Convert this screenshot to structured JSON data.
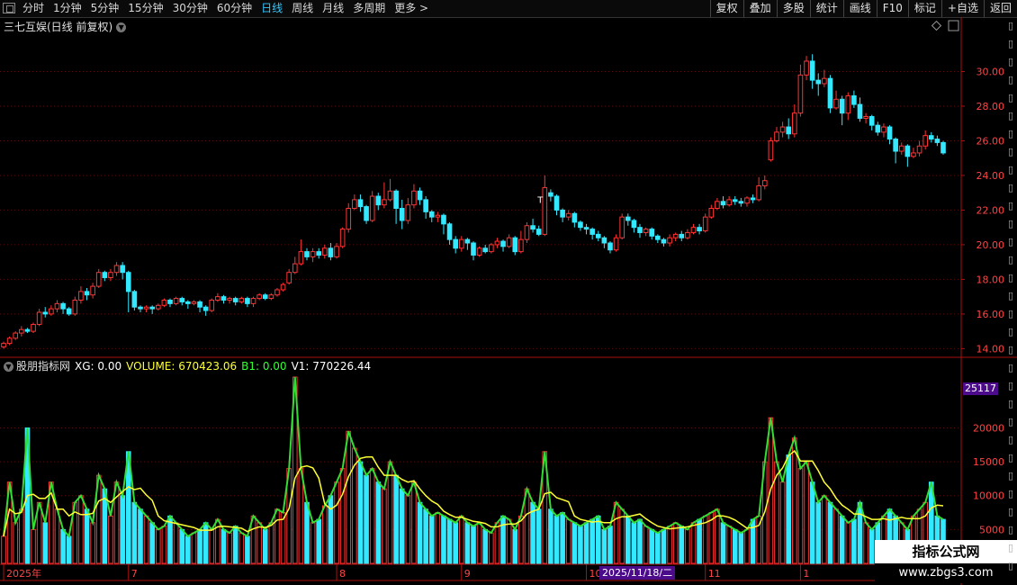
{
  "toolbar": {
    "timeframes": [
      "分时",
      "1分钟",
      "5分钟",
      "15分钟",
      "30分钟",
      "60分钟",
      "日线",
      "周线",
      "月线",
      "多周期",
      "更多 >"
    ],
    "active_index": 6,
    "right_buttons": [
      "复权",
      "叠加",
      "多股",
      "统计",
      "画线",
      "F10",
      "标记",
      "+自选",
      "返回"
    ]
  },
  "main_chart": {
    "title": "三七互娱(日线 前复权)",
    "title_icon": "chevron-down-icon",
    "y_ticks": [
      "30.00",
      "28.00",
      "26.00",
      "24.00",
      "22.00",
      "20.00",
      "18.00",
      "16.00",
      "14.00"
    ],
    "annotation": "T"
  },
  "indicator": {
    "name": "股朋指标网",
    "fields": [
      {
        "label": "XG: 0.00",
        "color": "#ffffff"
      },
      {
        "label": "VOLUME: 670423.06",
        "color": "#ffff33"
      },
      {
        "label": "B1: 0.00",
        "color": "#33ff33"
      },
      {
        "label": "V1: 770226.44",
        "color": "#ffffff"
      }
    ],
    "y_ticks": [
      "20000",
      "15000",
      "10000",
      "5000"
    ],
    "y_tag": "25117"
  },
  "x_axis": {
    "labels": [
      "2025年",
      "7",
      "8",
      "9",
      "10",
      "11",
      "1"
    ],
    "cursor_date": "2025/11/18/二"
  },
  "watermark": {
    "line1": "指标公式网",
    "line2": "www.zbgs3.com"
  },
  "colors": {
    "up": "#ff3333",
    "down": "#33e8ff",
    "ma": "#ffff33",
    "green": "#33dd33",
    "axis": "#aa1111"
  },
  "chart_data": {
    "type": "candlestick",
    "ylim": [
      13.5,
      32
    ],
    "candles": [
      [
        14.1,
        14.3,
        14.0,
        14.4
      ],
      [
        14.3,
        14.6,
        14.2,
        14.7
      ],
      [
        14.6,
        14.9,
        14.5,
        15.0
      ],
      [
        14.9,
        15.1,
        14.7,
        15.3
      ],
      [
        15.1,
        15.0,
        14.9,
        15.2
      ],
      [
        15.0,
        15.4,
        14.9,
        15.5
      ],
      [
        15.4,
        16.1,
        15.3,
        16.3
      ],
      [
        16.1,
        16.0,
        15.8,
        16.4
      ],
      [
        16.0,
        16.3,
        15.9,
        16.5
      ],
      [
        16.3,
        16.6,
        16.1,
        16.8
      ],
      [
        16.6,
        16.3,
        16.0,
        16.7
      ],
      [
        16.3,
        16.0,
        15.9,
        16.4
      ],
      [
        16.0,
        16.8,
        15.9,
        17.0
      ],
      [
        16.8,
        17.3,
        16.6,
        17.6
      ],
      [
        17.3,
        17.1,
        16.8,
        17.5
      ],
      [
        17.1,
        17.6,
        16.9,
        17.8
      ],
      [
        17.6,
        18.4,
        17.5,
        18.6
      ],
      [
        18.4,
        18.1,
        17.9,
        18.5
      ],
      [
        18.1,
        18.4,
        17.9,
        18.6
      ],
      [
        18.4,
        18.8,
        18.2,
        19.0
      ],
      [
        18.8,
        18.4,
        18.0,
        19.0
      ],
      [
        18.4,
        17.3,
        16.1,
        18.5
      ],
      [
        17.3,
        16.4,
        16.2,
        17.4
      ],
      [
        16.4,
        16.3,
        16.1,
        16.5
      ],
      [
        16.3,
        16.4,
        16.1,
        16.5
      ],
      [
        16.4,
        16.3,
        16.0,
        16.5
      ],
      [
        16.3,
        16.5,
        16.2,
        16.6
      ],
      [
        16.5,
        16.8,
        16.4,
        16.9
      ],
      [
        16.8,
        16.6,
        16.4,
        16.9
      ],
      [
        16.6,
        16.9,
        16.5,
        17.0
      ],
      [
        16.9,
        16.7,
        16.5,
        17.0
      ],
      [
        16.7,
        16.6,
        16.3,
        16.8
      ],
      [
        16.6,
        16.7,
        16.5,
        16.8
      ],
      [
        16.7,
        16.4,
        16.1,
        16.8
      ],
      [
        16.4,
        16.2,
        15.9,
        16.5
      ],
      [
        16.2,
        16.8,
        16.1,
        16.9
      ],
      [
        16.8,
        17.0,
        16.7,
        17.2
      ],
      [
        17.0,
        16.8,
        16.6,
        17.1
      ],
      [
        16.8,
        16.9,
        16.6,
        17.0
      ],
      [
        16.9,
        16.7,
        16.5,
        17.0
      ],
      [
        16.7,
        16.9,
        16.6,
        17.0
      ],
      [
        16.9,
        16.6,
        16.4,
        17.0
      ],
      [
        16.6,
        16.9,
        16.4,
        17.0
      ],
      [
        16.9,
        17.1,
        16.8,
        17.2
      ],
      [
        17.1,
        16.9,
        16.8,
        17.2
      ],
      [
        16.9,
        17.1,
        16.8,
        17.2
      ],
      [
        17.1,
        17.4,
        17.0,
        17.5
      ],
      [
        17.4,
        17.7,
        17.3,
        17.8
      ],
      [
        17.8,
        18.4,
        17.7,
        18.6
      ],
      [
        18.4,
        18.9,
        18.3,
        19.3
      ],
      [
        18.9,
        19.6,
        18.8,
        20.3
      ],
      [
        19.6,
        19.3,
        19.1,
        19.8
      ],
      [
        19.3,
        19.6,
        19.0,
        19.8
      ],
      [
        19.6,
        19.4,
        19.2,
        19.8
      ],
      [
        19.4,
        19.8,
        19.2,
        20.0
      ],
      [
        19.8,
        19.3,
        19.1,
        20.1
      ],
      [
        19.3,
        19.9,
        19.2,
        20.1
      ],
      [
        19.9,
        20.9,
        19.8,
        21.0
      ],
      [
        20.9,
        22.1,
        20.7,
        22.4
      ],
      [
        22.1,
        22.6,
        22.0,
        22.9
      ],
      [
        22.6,
        22.2,
        21.9,
        22.9
      ],
      [
        22.2,
        21.4,
        21.2,
        22.3
      ],
      [
        21.4,
        22.8,
        21.3,
        23.1
      ],
      [
        22.8,
        22.3,
        22.0,
        23.0
      ],
      [
        22.3,
        22.6,
        22.1,
        23.6
      ],
      [
        22.6,
        23.1,
        22.5,
        23.8
      ],
      [
        23.1,
        22.1,
        21.2,
        23.2
      ],
      [
        22.1,
        21.4,
        20.9,
        22.6
      ],
      [
        21.4,
        22.3,
        21.2,
        22.7
      ],
      [
        22.3,
        23.1,
        22.1,
        23.5
      ],
      [
        23.1,
        22.6,
        22.3,
        23.3
      ],
      [
        22.6,
        21.9,
        21.5,
        22.8
      ],
      [
        21.9,
        21.6,
        21.3,
        22.0
      ],
      [
        21.6,
        21.7,
        21.3,
        21.9
      ],
      [
        21.7,
        21.2,
        20.6,
        21.8
      ],
      [
        21.2,
        20.3,
        20.0,
        21.3
      ],
      [
        20.3,
        19.8,
        19.5,
        20.5
      ],
      [
        19.8,
        20.3,
        19.6,
        20.5
      ],
      [
        20.3,
        20.1,
        19.7,
        20.4
      ],
      [
        20.1,
        19.4,
        19.1,
        20.2
      ],
      [
        19.4,
        19.8,
        19.3,
        19.9
      ],
      [
        19.8,
        19.6,
        19.5,
        20.0
      ],
      [
        19.6,
        20.0,
        19.5,
        20.1
      ],
      [
        20.0,
        20.2,
        19.8,
        20.4
      ],
      [
        20.2,
        19.9,
        19.6,
        20.3
      ],
      [
        19.9,
        20.4,
        19.8,
        20.6
      ],
      [
        20.4,
        19.6,
        19.4,
        20.5
      ],
      [
        19.6,
        20.3,
        19.5,
        20.8
      ],
      [
        20.3,
        21.1,
        20.1,
        21.3
      ],
      [
        21.1,
        20.9,
        20.7,
        21.5
      ],
      [
        20.9,
        20.6,
        20.5,
        21.1
      ],
      [
        20.6,
        23.3,
        20.5,
        24.0
      ],
      [
        23.0,
        22.8,
        22.5,
        23.2
      ],
      [
        22.8,
        22.0,
        21.7,
        22.9
      ],
      [
        22.0,
        21.6,
        21.3,
        22.1
      ],
      [
        21.6,
        21.8,
        21.4,
        22.0
      ],
      [
        21.8,
        21.3,
        21.0,
        21.9
      ],
      [
        21.3,
        21.0,
        20.8,
        21.4
      ],
      [
        21.0,
        20.9,
        20.6,
        21.2
      ],
      [
        20.9,
        20.6,
        20.3,
        21.0
      ],
      [
        20.6,
        20.4,
        20.2,
        20.8
      ],
      [
        20.4,
        20.1,
        19.8,
        20.5
      ],
      [
        20.1,
        19.7,
        19.5,
        20.2
      ],
      [
        19.7,
        20.4,
        19.6,
        20.6
      ],
      [
        20.4,
        21.6,
        20.3,
        21.8
      ],
      [
        21.6,
        21.4,
        21.1,
        21.8
      ],
      [
        21.4,
        21.0,
        20.7,
        21.5
      ],
      [
        21.0,
        20.7,
        20.4,
        21.2
      ],
      [
        20.7,
        20.9,
        20.5,
        21.0
      ],
      [
        20.9,
        20.5,
        20.3,
        21.0
      ],
      [
        20.5,
        20.3,
        20.1,
        20.6
      ],
      [
        20.3,
        20.1,
        19.9,
        20.4
      ],
      [
        20.1,
        20.4,
        19.9,
        20.6
      ],
      [
        20.4,
        20.6,
        20.2,
        20.7
      ],
      [
        20.6,
        20.4,
        20.2,
        20.8
      ],
      [
        20.4,
        20.7,
        20.3,
        20.9
      ],
      [
        20.7,
        21.0,
        20.6,
        21.2
      ],
      [
        21.0,
        20.8,
        20.6,
        21.2
      ],
      [
        20.8,
        21.6,
        20.7,
        21.8
      ],
      [
        21.6,
        22.1,
        21.5,
        22.3
      ],
      [
        22.1,
        22.5,
        22.0,
        22.7
      ],
      [
        22.5,
        22.3,
        22.1,
        22.8
      ],
      [
        22.3,
        22.6,
        22.2,
        22.8
      ],
      [
        22.6,
        22.5,
        22.3,
        22.8
      ],
      [
        22.5,
        22.4,
        22.2,
        22.7
      ],
      [
        22.4,
        22.7,
        22.2,
        22.8
      ],
      [
        22.7,
        22.6,
        22.4,
        22.9
      ],
      [
        22.6,
        23.4,
        22.5,
        23.9
      ],
      [
        23.4,
        23.7,
        23.2,
        24.0
      ],
      [
        24.9,
        26.0,
        24.8,
        26.2
      ],
      [
        26.0,
        26.5,
        25.9,
        26.8
      ],
      [
        26.5,
        26.8,
        26.2,
        27.1
      ],
      [
        26.8,
        26.4,
        26.1,
        27.3
      ],
      [
        26.4,
        27.6,
        26.2,
        28.1
      ],
      [
        27.6,
        29.8,
        27.4,
        30.4
      ],
      [
        29.8,
        30.6,
        29.5,
        30.9
      ],
      [
        30.6,
        29.5,
        29.0,
        31.0
      ],
      [
        29.5,
        29.3,
        28.6,
        29.9
      ],
      [
        29.3,
        29.6,
        29.1,
        30.1
      ],
      [
        29.6,
        27.9,
        27.6,
        29.8
      ],
      [
        27.9,
        28.4,
        27.8,
        28.9
      ],
      [
        28.4,
        27.6,
        26.9,
        28.6
      ],
      [
        27.6,
        28.6,
        27.2,
        28.8
      ],
      [
        28.6,
        28.1,
        27.9,
        28.9
      ],
      [
        28.1,
        27.3,
        27.1,
        28.5
      ],
      [
        27.3,
        27.4,
        27.0,
        27.6
      ],
      [
        27.4,
        26.9,
        26.6,
        27.5
      ],
      [
        26.9,
        26.5,
        26.3,
        27.1
      ],
      [
        26.5,
        26.8,
        26.2,
        27.0
      ],
      [
        26.8,
        26.1,
        25.8,
        26.9
      ],
      [
        26.1,
        25.4,
        24.7,
        26.2
      ],
      [
        25.4,
        25.7,
        25.2,
        25.9
      ],
      [
        25.7,
        25.1,
        24.5,
        25.8
      ],
      [
        25.1,
        25.3,
        25.0,
        25.6
      ],
      [
        25.3,
        25.7,
        25.1,
        26.0
      ],
      [
        25.7,
        26.3,
        25.5,
        26.6
      ],
      [
        26.3,
        26.1,
        25.9,
        26.5
      ],
      [
        26.1,
        25.9,
        25.7,
        26.3
      ],
      [
        25.9,
        25.3,
        25.2,
        26.0
      ]
    ],
    "volume_ylim": [
      0,
      27500
    ],
    "volumes": [
      4000,
      12000,
      6000,
      8000,
      20000,
      5000,
      9000,
      6000,
      12000,
      8000,
      5000,
      4000,
      9000,
      10000,
      8000,
      6000,
      13000,
      11000,
      7000,
      12000,
      10000,
      16500,
      9000,
      8000,
      7000,
      6000,
      5000,
      5500,
      7000,
      6000,
      5000,
      4000,
      4500,
      5000,
      6000,
      5000,
      6500,
      5000,
      4500,
      5500,
      4500,
      4000,
      7000,
      6000,
      5000,
      6000,
      8000,
      7500,
      14000,
      27500,
      14000,
      9000,
      6000,
      6500,
      8500,
      10000,
      12000,
      14000,
      19500,
      17000,
      15000,
      13000,
      14000,
      12000,
      11000,
      15000,
      13000,
      11000,
      10000,
      12000,
      9000,
      8000,
      7000,
      7500,
      7000,
      6500,
      6000,
      7000,
      6000,
      5500,
      6000,
      5000,
      4500,
      6000,
      7000,
      6500,
      5000,
      7000,
      11000,
      9000,
      8000,
      16500,
      8000,
      7000,
      7500,
      6500,
      6000,
      5500,
      6000,
      6500,
      7000,
      5000,
      5500,
      9000,
      8000,
      7000,
      6000,
      6500,
      5500,
      5000,
      4500,
      5000,
      5500,
      6000,
      5500,
      5000,
      6000,
      6500,
      7000,
      7500,
      8000,
      6000,
      5500,
      5000,
      4500,
      5000,
      6500,
      7000,
      15000,
      21500,
      15000,
      12000,
      16000,
      18500,
      14000,
      15000,
      12000,
      9000,
      10000,
      9000,
      8000,
      7000,
      6000,
      6500,
      9000,
      6000,
      5000,
      6000,
      7000,
      8000,
      7000,
      6000,
      5000,
      7000,
      8000,
      9000,
      12000,
      7000,
      6500
    ]
  }
}
